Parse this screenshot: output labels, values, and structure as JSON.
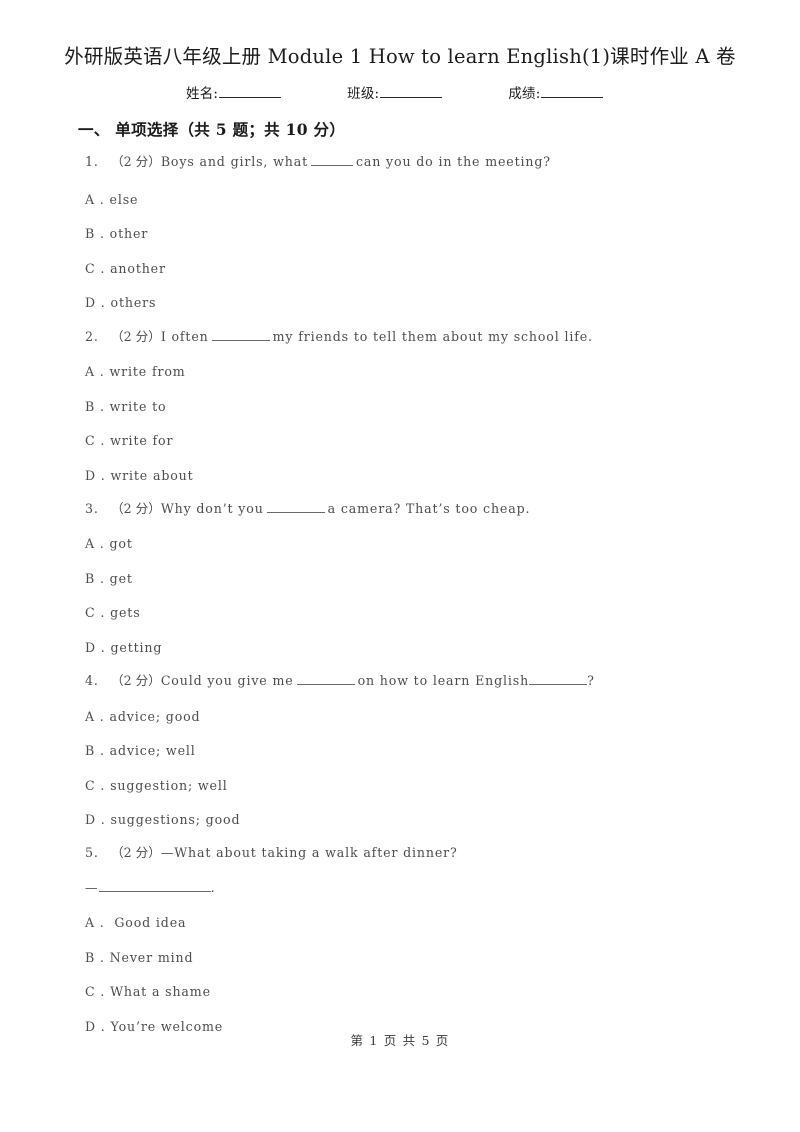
{
  "document": {
    "title": "外研版英语八年级上册 Module 1 How to learn English(1)课时作业 A 卷",
    "info_fields": [
      {
        "label": "姓名:"
      },
      {
        "label": "班级:"
      },
      {
        "label": "成绩:"
      }
    ],
    "footer": "第 1 页 共 5 页"
  },
  "sections": [
    {
      "heading": "一、 单项选择（共 5 题；共 10 分）",
      "questions": [
        {
          "number": "1.",
          "marks": "（2 分）",
          "text_before": "Boys and girls, what",
          "blank": "b-short",
          "text_after": "can you do in the meeting?",
          "options": [
            {
              "key": "A .",
              "label": "else"
            },
            {
              "key": "B .",
              "label": "other"
            },
            {
              "key": "C .",
              "label": "another"
            },
            {
              "key": "D .",
              "label": "others"
            }
          ]
        },
        {
          "number": "2.",
          "marks": "（2 分）",
          "text_before": "I often",
          "blank": "b-med",
          "text_after": "my friends to tell them about my school life.",
          "options": [
            {
              "key": "A .",
              "label": "write from"
            },
            {
              "key": "B .",
              "label": "write to"
            },
            {
              "key": "C .",
              "label": "write for"
            },
            {
              "key": "D .",
              "label": "write about"
            }
          ]
        },
        {
          "number": "3.",
          "marks": "（2 分）",
          "text_before": "Why don’t you",
          "blank": "b-med",
          "text_after": "a camera? That’s too cheap.",
          "options": [
            {
              "key": "A .",
              "label": "got"
            },
            {
              "key": "B .",
              "label": "get"
            },
            {
              "key": "C .",
              "label": "gets"
            },
            {
              "key": "D .",
              "label": "getting"
            }
          ]
        },
        {
          "number": "4.",
          "marks": "（2 分）",
          "text_before": "Could you give me",
          "blank": "b-med",
          "text_after": "on how to learn English",
          "blank2": "b-tight",
          "text_end": "?",
          "options": [
            {
              "key": "A .",
              "label": "advice; good"
            },
            {
              "key": "B .",
              "label": "advice; well"
            },
            {
              "key": "C .",
              "label": "suggestion; well"
            },
            {
              "key": "D .",
              "label": "suggestions; good"
            }
          ]
        },
        {
          "number": "5.",
          "marks": "（2 分）",
          "text_before": "—What about taking a walk after dinner?",
          "continuation_dash": "—",
          "continuation_blank": "b-long",
          "continuation_end": ".",
          "options": [
            {
              "key": "A .",
              "label": " Good idea"
            },
            {
              "key": "B .",
              "label": "Never mind"
            },
            {
              "key": "C .",
              "label": "What a shame"
            },
            {
              "key": "D .",
              "label": "You’re welcome"
            }
          ]
        }
      ]
    }
  ]
}
